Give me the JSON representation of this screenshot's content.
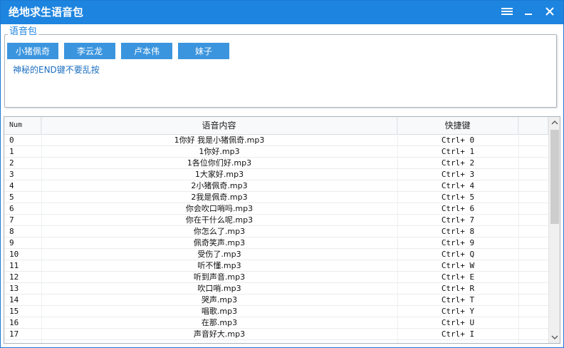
{
  "window": {
    "title": "绝地求生语音包"
  },
  "group": {
    "legend": "语音包",
    "buttons": [
      {
        "label": "小猪佩奇"
      },
      {
        "label": "李云龙"
      },
      {
        "label": "卢本伟"
      },
      {
        "label": "妹子"
      }
    ],
    "tip": "神秘的END键不要乱按"
  },
  "table": {
    "columns": [
      "Num",
      "语音内容",
      "快捷键"
    ],
    "rows": [
      {
        "num": "0",
        "content": "1你好 我是小猪佩奇.mp3",
        "key": "Ctrl+ 0"
      },
      {
        "num": "1",
        "content": "1你好.mp3",
        "key": "Ctrl+ 1"
      },
      {
        "num": "2",
        "content": "1各位你们好.mp3",
        "key": "Ctrl+ 2"
      },
      {
        "num": "3",
        "content": "1大家好.mp3",
        "key": "Ctrl+ 3"
      },
      {
        "num": "4",
        "content": "2小猪佩奇.mp3",
        "key": "Ctrl+ 4"
      },
      {
        "num": "5",
        "content": "2我是佩奇.mp3",
        "key": "Ctrl+ 5"
      },
      {
        "num": "6",
        "content": "你会吹口哨吗.mp3",
        "key": "Ctrl+ 6"
      },
      {
        "num": "7",
        "content": "你在干什么呢.mp3",
        "key": "Ctrl+ 7"
      },
      {
        "num": "8",
        "content": "你怎么了.mp3",
        "key": "Ctrl+ 8"
      },
      {
        "num": "9",
        "content": "佩奇笑声.mp3",
        "key": "Ctrl+ 9"
      },
      {
        "num": "10",
        "content": "受伤了.mp3",
        "key": "Ctrl+ Q"
      },
      {
        "num": "11",
        "content": "听不懂.mp3",
        "key": "Ctrl+ W"
      },
      {
        "num": "12",
        "content": "听到声音.mp3",
        "key": "Ctrl+ E"
      },
      {
        "num": "13",
        "content": "吹口哨.mp3",
        "key": "Ctrl+ R"
      },
      {
        "num": "14",
        "content": "哭声.mp3",
        "key": "Ctrl+ T"
      },
      {
        "num": "15",
        "content": "唱歌.mp3",
        "key": "Ctrl+ Y"
      },
      {
        "num": "16",
        "content": "在那.mp3",
        "key": "Ctrl+ U"
      },
      {
        "num": "17",
        "content": "声音好大.mp3",
        "key": "Ctrl+ I"
      }
    ]
  },
  "scrollbar": {
    "position": 0.0,
    "visible_fraction": 0.47
  },
  "icons": {
    "menu": "menu-icon",
    "minimize": "minimize-icon",
    "close": "close-icon",
    "scroll_up": "chevron-up-icon",
    "scroll_down": "chevron-down-icon"
  },
  "colors": {
    "titlebar": "#1d84df",
    "button": "#3b95de",
    "legend": "#1d84df",
    "tip": "#1d6fbf"
  }
}
